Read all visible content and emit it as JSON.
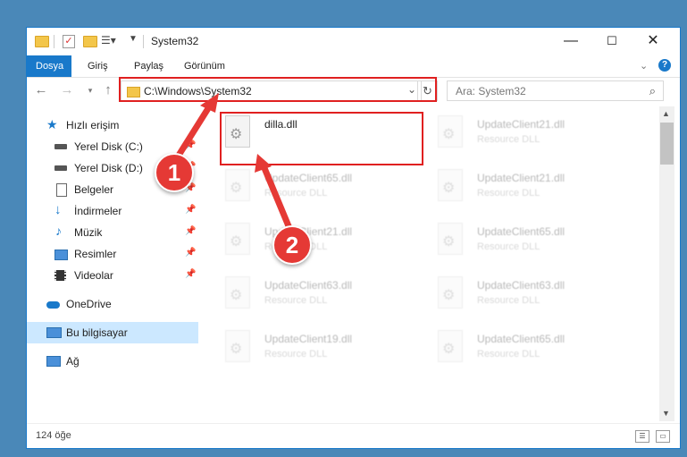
{
  "window": {
    "title": "System32"
  },
  "quick_access_icons": [
    "folder-icon",
    "properties-check-icon",
    "new-folder-icon",
    "customize-icon"
  ],
  "ribbon": {
    "tabs": [
      "Dosya",
      "Giriş",
      "Paylaş",
      "Görünüm"
    ]
  },
  "address": {
    "path": "C:\\Windows\\System32"
  },
  "search": {
    "placeholder": "Ara: System32"
  },
  "sidebar": {
    "items": [
      {
        "label": "Hızlı erişim"
      },
      {
        "label": "Yerel Disk (C:)"
      },
      {
        "label": "Yerel Disk (D:)"
      },
      {
        "label": "Belgeler"
      },
      {
        "label": "İndirmeler"
      },
      {
        "label": "Müzik"
      },
      {
        "label": "Resimler"
      },
      {
        "label": "Videolar"
      },
      {
        "label": "OneDrive"
      },
      {
        "label": "Bu bilgisayar"
      },
      {
        "label": "Ağ"
      }
    ]
  },
  "files": {
    "left": [
      {
        "name": "dilla.dll",
        "type": ""
      },
      {
        "name": "UpdateClient65.dll",
        "type": "Resource DLL"
      },
      {
        "name": "UpdateClient21.dll",
        "type": "Resource DLL"
      },
      {
        "name": "UpdateClient63.dll",
        "type": "Resource DLL"
      },
      {
        "name": "UpdateClient19.dll",
        "type": "Resource DLL"
      }
    ],
    "right": [
      {
        "name": "UpdateClient21.dll",
        "type": "Resource DLL"
      },
      {
        "name": "UpdateClient21.dll",
        "type": "Resource DLL"
      },
      {
        "name": "UpdateClient65.dll",
        "type": "Resource DLL"
      },
      {
        "name": "UpdateClient63.dll",
        "type": "Resource DLL"
      },
      {
        "name": "UpdateClient65.dll",
        "type": "Resource DLL"
      }
    ]
  },
  "status": {
    "count": "124 öğe"
  },
  "callouts": {
    "one": "1",
    "two": "2"
  },
  "colors": {
    "accent": "#1979ca",
    "highlight": "#e02020",
    "callout": "#e53935",
    "selection": "#cce8ff"
  }
}
